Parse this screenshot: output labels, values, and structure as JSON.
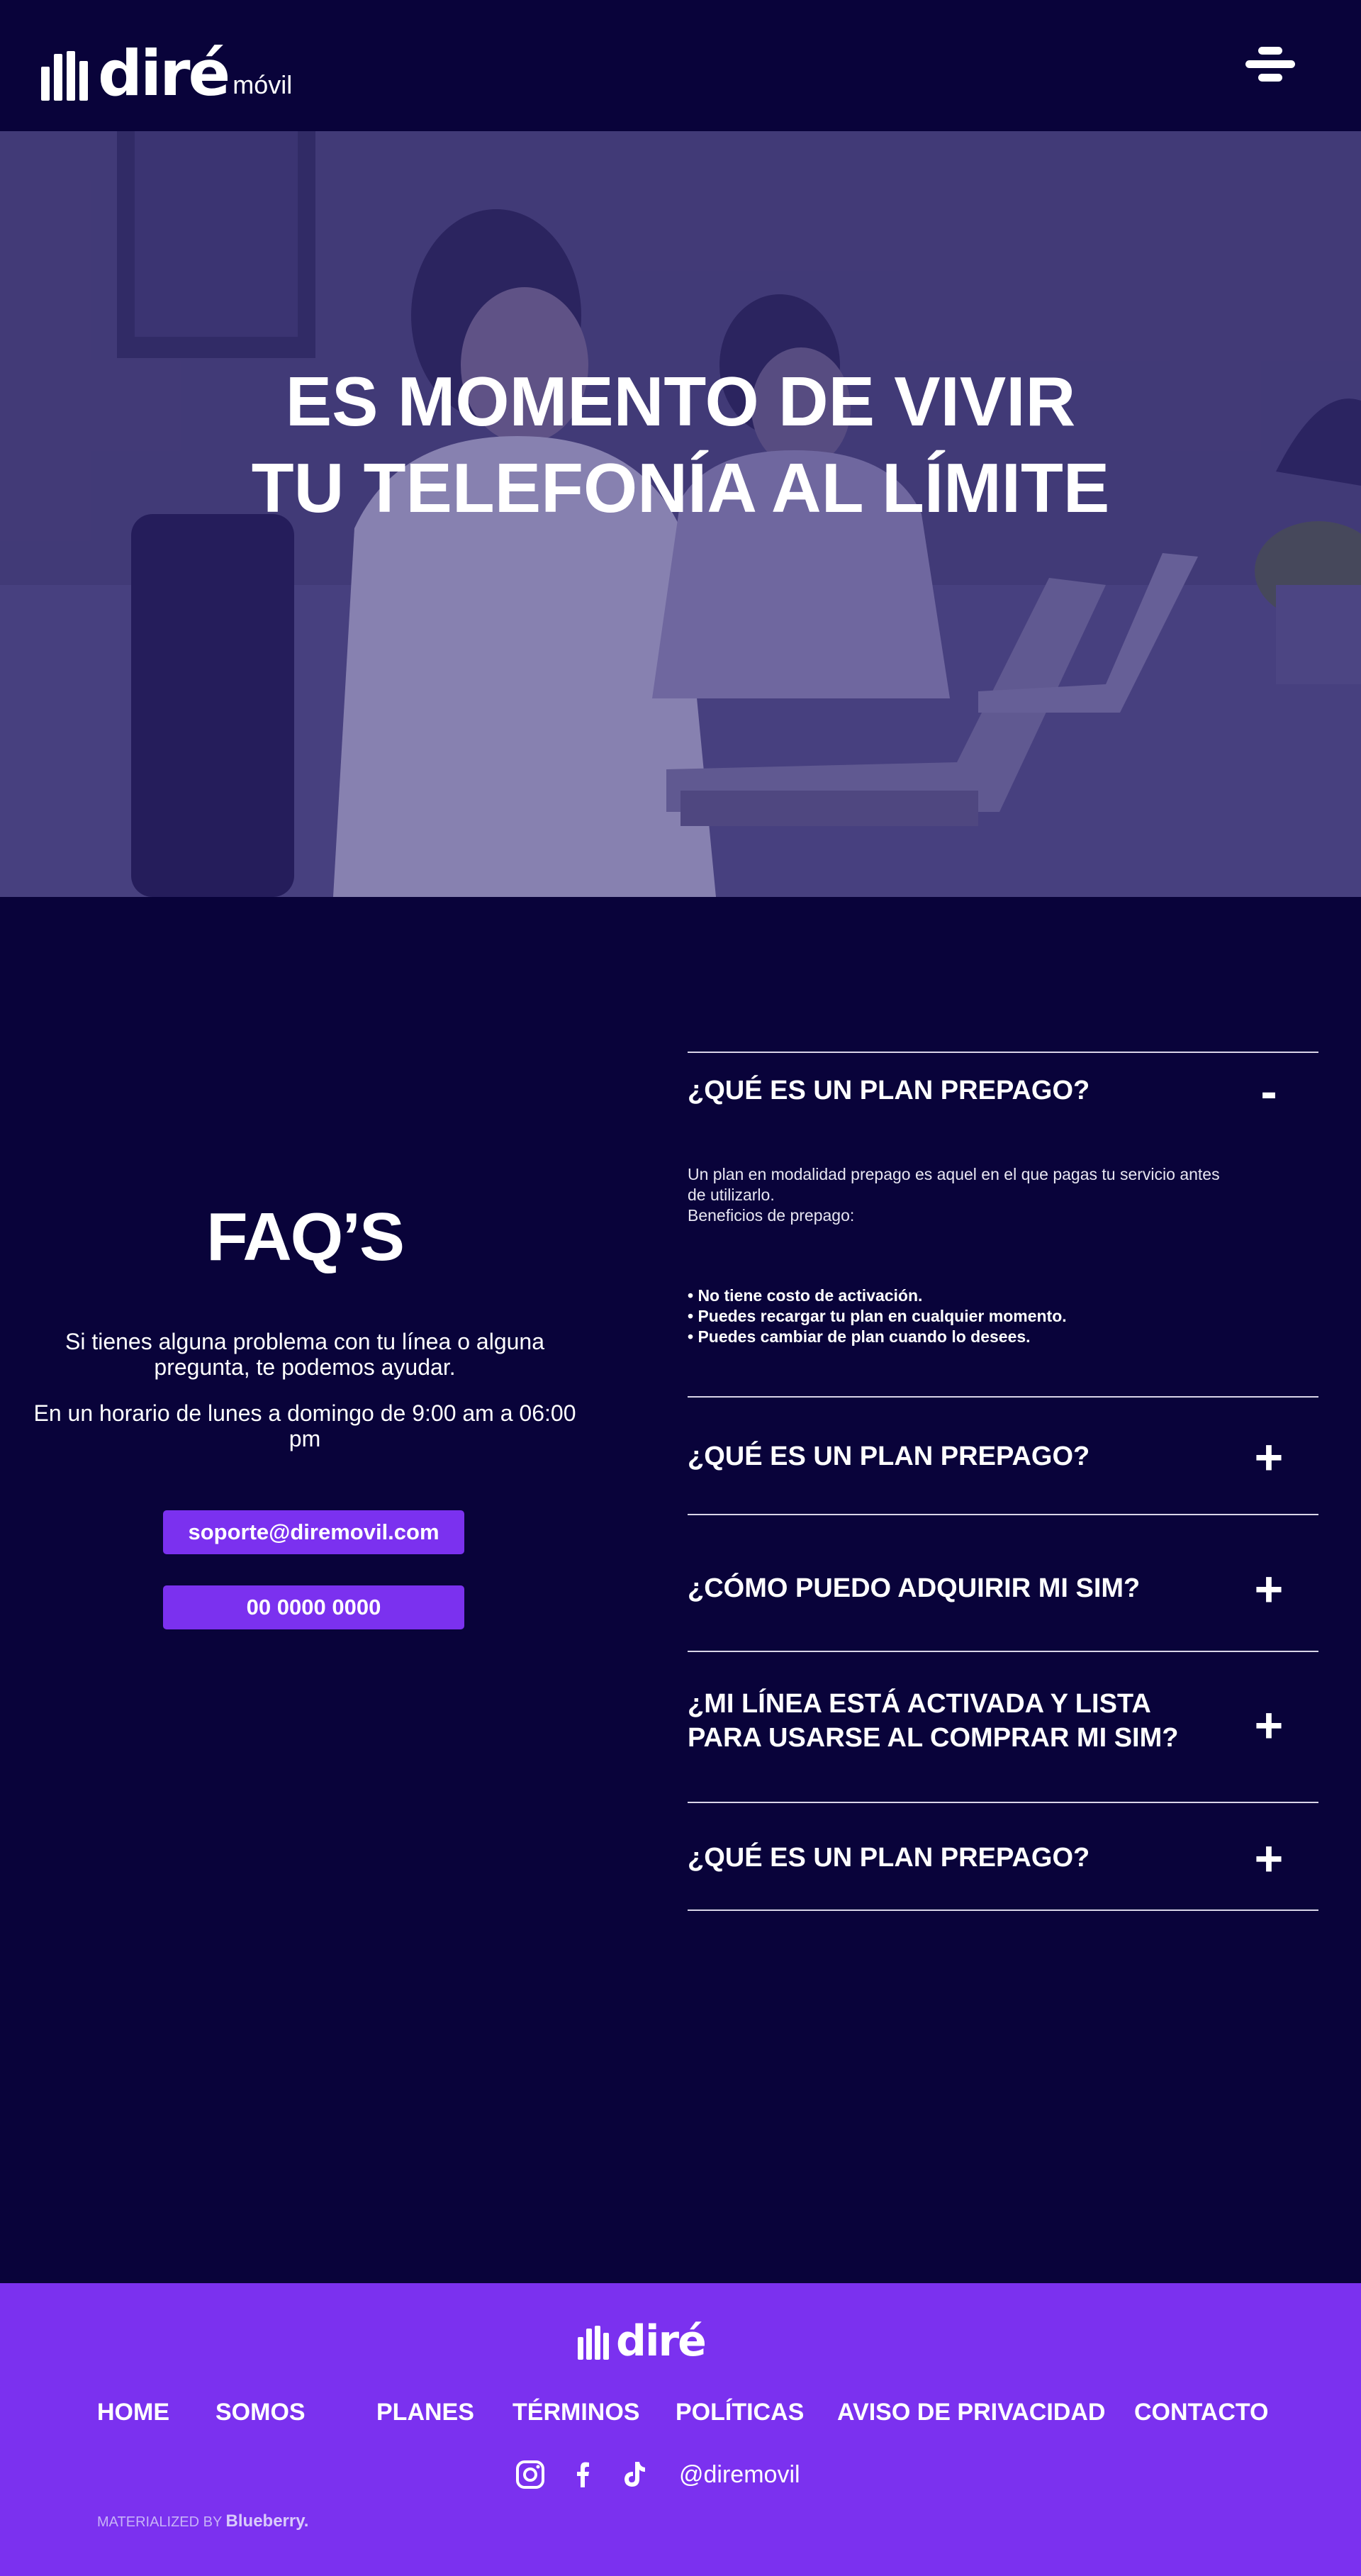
{
  "header": {
    "logo_word": "diré",
    "logo_sub": "móvil",
    "menu_icon": "hamburger-menu-icon"
  },
  "hero": {
    "title_line1": "ES MOMENTO DE VIVIR",
    "title_line2": "TU TELEFONÍA AL LÍMITE"
  },
  "faq": {
    "heading": "FAQ’S",
    "intro": "Si tienes alguna problema con tu línea o alguna pregunta, te podemos ayudar.",
    "hours": "En un horario de lunes a domingo de 9:00 am a 06:00 pm",
    "email": "soporte@diremovil.com",
    "phone": "00 0000 0000",
    "items": [
      {
        "question": "¿QUÉ ES UN PLAN PREPAGO?",
        "toggle": "-",
        "expanded": true,
        "answer": "Un plan en modalidad prepago es aquel en el que pagas tu servicio antes de utilizarlo.",
        "answer_sub": "Beneficios de prepago:",
        "bullets": [
          "• No tiene costo de activación.",
          "• Puedes recargar tu plan en cualquier momento.",
          "• Puedes cambiar de plan cuando lo desees."
        ]
      },
      {
        "question": "¿QUÉ ES UN PLAN PREPAGO?",
        "toggle": "+",
        "expanded": false
      },
      {
        "question": "¿CÓMO PUEDO ADQUIRIR MI SIM?",
        "toggle": "+",
        "expanded": false
      },
      {
        "question": "¿MI LÍNEA ESTÁ ACTIVADA Y LISTA PARA USARSE AL COMPRAR MI SIM?",
        "toggle": "+",
        "expanded": false
      },
      {
        "question": "¿QUÉ ES UN PLAN PREPAGO?",
        "toggle": "+",
        "expanded": false
      }
    ]
  },
  "footer": {
    "logo_word": "diré",
    "nav": [
      "HOME",
      "SOMOS",
      "PLANES",
      "TÉRMINOS",
      "POLÍTICAS",
      "AVISO DE PRIVACIDAD",
      "CONTACTO"
    ],
    "social_icons": [
      "instagram-icon",
      "facebook-icon",
      "tiktok-icon"
    ],
    "handle": "@diremovil",
    "credit_prefix": "MATERIALIZED BY",
    "credit_brand": "Blueberry."
  },
  "colors": {
    "background": "#09033a",
    "accent": "#7b31ef",
    "text": "#ffffff"
  }
}
